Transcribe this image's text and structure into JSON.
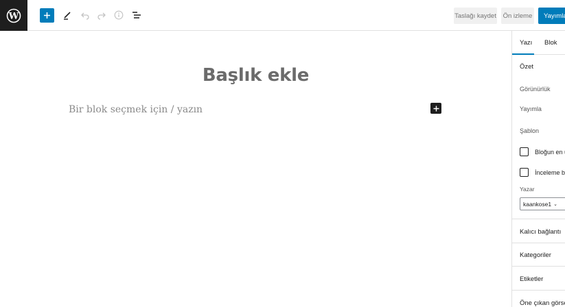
{
  "toolbar": {
    "save_draft_label": "Taslağı kaydet",
    "preview_label": "Ön izleme",
    "publish_label": "Yayımla"
  },
  "editor": {
    "title_placeholder": "Başlık ekle",
    "block_placeholder": "Bir blok seçmek için / yazın"
  },
  "sidebar": {
    "tabs": [
      "Yazı",
      "Blok"
    ],
    "summary_heading": "Özet",
    "visibility_label": "Görünürlük",
    "publish_label": "Yayımla",
    "template_label": "Şablon",
    "sticky_label": "Bloğun en üstüne sabitle",
    "pending_label": "İnceleme bekliyor",
    "author_label": "Yazar",
    "author_value": "kaankose1",
    "permalink_heading": "Kalıcı bağlantı",
    "categories_heading": "Kategoriler",
    "tags_heading": "Etiketler",
    "featured_heading": "Öne çıkan görsel"
  },
  "icons": [
    "wordpress-logo-icon",
    "plus-icon",
    "pencil-icon",
    "undo-icon",
    "redo-icon",
    "info-icon",
    "list-view-icon",
    "chevron-down-icon"
  ],
  "colors": {
    "accent": "#007cba",
    "dark": "#1e1e1e"
  }
}
